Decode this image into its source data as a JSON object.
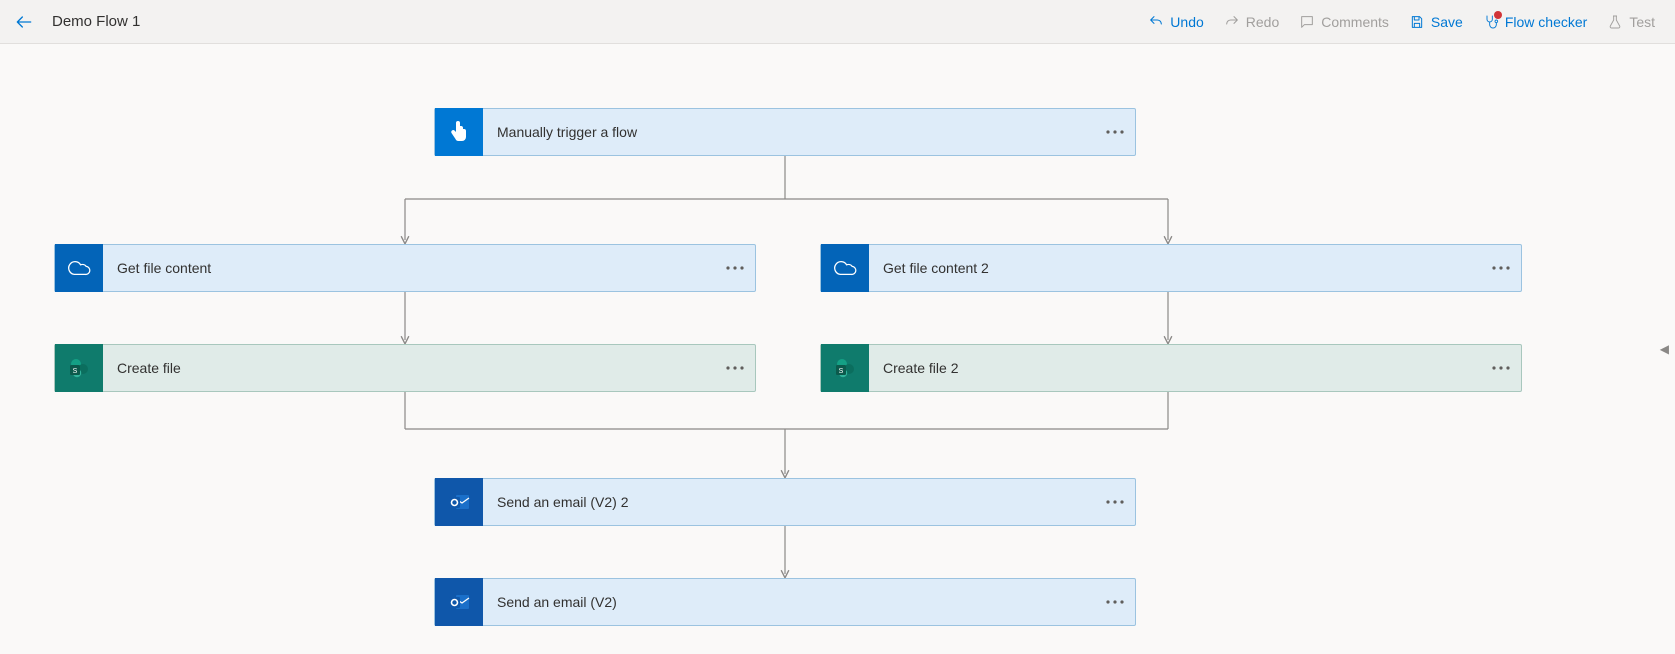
{
  "header": {
    "title": "Demo Flow 1",
    "toolbar": {
      "undo": "Undo",
      "redo": "Redo",
      "comments": "Comments",
      "save": "Save",
      "checker": "Flow checker",
      "test": "Test"
    }
  },
  "nodes": {
    "trigger": "Manually trigger a flow",
    "get1": "Get file content",
    "get2": "Get file content 2",
    "create1": "Create file",
    "create2": "Create file 2",
    "email2": "Send an email (V2) 2",
    "email": "Send an email (V2)"
  }
}
